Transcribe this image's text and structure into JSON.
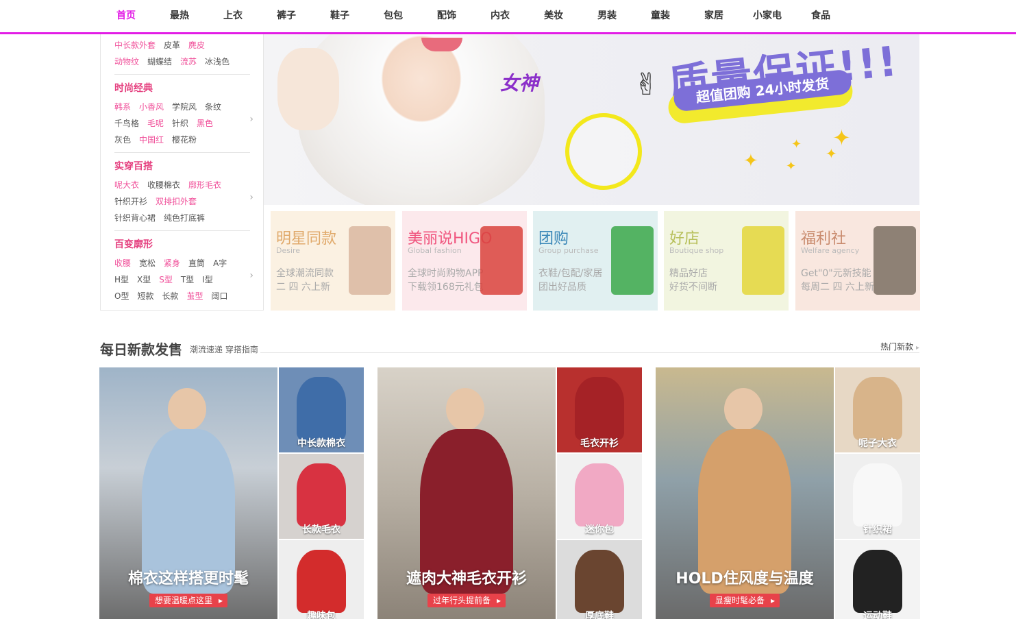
{
  "nav": {
    "items": [
      "首页",
      "最热",
      "上衣",
      "裤子",
      "鞋子",
      "包包",
      "配饰",
      "内衣",
      "美妆",
      "男装",
      "童装",
      "家居",
      "小家电",
      "食品"
    ],
    "active_index": 0
  },
  "sidebar": {
    "partial_rows": [
      [
        {
          "t": "中长款外套",
          "c": "pink"
        },
        {
          "t": "皮革",
          "c": "dark"
        },
        {
          "t": "麂皮",
          "c": "pink"
        }
      ],
      [
        {
          "t": "动物纹",
          "c": "pink"
        },
        {
          "t": "蝴蝶结",
          "c": "dark"
        },
        {
          "t": "流苏",
          "c": "pink"
        },
        {
          "t": "冰浅色",
          "c": "dark"
        }
      ]
    ],
    "groups": [
      {
        "title": "时尚经典",
        "rows": [
          [
            {
              "t": "韩系",
              "c": "pink"
            },
            {
              "t": "小香风",
              "c": "pink"
            },
            {
              "t": "学院风",
              "c": "dark"
            },
            {
              "t": "条纹",
              "c": "dark"
            }
          ],
          [
            {
              "t": "千鸟格",
              "c": "dark"
            },
            {
              "t": "毛呢",
              "c": "pink"
            },
            {
              "t": "针织",
              "c": "dark"
            },
            {
              "t": "黑色",
              "c": "pink"
            }
          ],
          [
            {
              "t": "灰色",
              "c": "dark"
            },
            {
              "t": "中国红",
              "c": "pink"
            },
            {
              "t": "樱花粉",
              "c": "dark"
            }
          ]
        ]
      },
      {
        "title": "实穿百搭",
        "rows": [
          [
            {
              "t": "呢大衣",
              "c": "pink"
            },
            {
              "t": "收腰棉衣",
              "c": "dark"
            },
            {
              "t": "廓形毛衣",
              "c": "pink"
            }
          ],
          [
            {
              "t": "针织开衫",
              "c": "dark"
            },
            {
              "t": "双排扣外套",
              "c": "pink"
            }
          ],
          [
            {
              "t": "针织背心裙",
              "c": "dark"
            },
            {
              "t": "纯色打底裤",
              "c": "dark"
            }
          ]
        ]
      },
      {
        "title": "百变廓形",
        "rows": [
          [
            {
              "t": "收腰",
              "c": "pink"
            },
            {
              "t": "宽松",
              "c": "dark"
            },
            {
              "t": "紧身",
              "c": "pink"
            },
            {
              "t": "直筒",
              "c": "dark"
            },
            {
              "t": "A字",
              "c": "dark"
            }
          ],
          [
            {
              "t": "H型",
              "c": "dark"
            },
            {
              "t": "X型",
              "c": "dark"
            },
            {
              "t": "S型",
              "c": "pink"
            },
            {
              "t": "T型",
              "c": "dark"
            },
            {
              "t": "I型",
              "c": "dark"
            }
          ],
          [
            {
              "t": "O型",
              "c": "dark"
            },
            {
              "t": "短款",
              "c": "dark"
            },
            {
              "t": "长款",
              "c": "dark"
            },
            {
              "t": "茧型",
              "c": "pink"
            },
            {
              "t": "阔口",
              "c": "dark"
            }
          ]
        ]
      }
    ]
  },
  "banner": {
    "goddess": "女神",
    "title": "质量保证",
    "exclaim": "!!!",
    "ribbon": "超值团购 24小时发货"
  },
  "promos": [
    {
      "title": "明星同款",
      "sub": "Desire",
      "l1": "全球潮流同款",
      "l2": "二 四 六上新",
      "title_color": "#e0a96a",
      "bg": "#fbf1e2",
      "thumb": "#d9b7a0"
    },
    {
      "title": "美丽说HIGO",
      "sub": "Global fashion",
      "l1": "全球时尚购物APP",
      "l2": "下载领168元礼包",
      "title_color": "#f0557e",
      "bg": "#fce9ec",
      "thumb": "#d9433d"
    },
    {
      "title": "团购",
      "sub": "Group purchase",
      "l1": "衣鞋/包配/家居",
      "l2": "团出好品质",
      "title_color": "#3c88b8",
      "bg": "#e1f0f1",
      "thumb": "#3ba84a"
    },
    {
      "title": "好店",
      "sub": "Boutique shop",
      "l1": "精品好店",
      "l2": "好货不间断",
      "title_color": "#b7bf5a",
      "bg": "#f2f5e0",
      "thumb": "#e4d63a"
    },
    {
      "title": "福利社",
      "sub": "Welfare agency",
      "l1": "Get\"0\"元新技能",
      "l2": "每周二 四 六上新",
      "title_color": "#c98b6e",
      "bg": "#f9e7df",
      "thumb": "#7b6e63"
    }
  ],
  "section": {
    "title": "每日新款发售",
    "subtitle": "潮流速递 穿搭指南",
    "more": "热门新款"
  },
  "products": [
    {
      "big": {
        "caption": "棉衣这样搭更时髦",
        "tag": "想要温暖点这里"
      },
      "smalls": [
        {
          "caption": "中长款棉衣"
        },
        {
          "caption": "长款毛衣"
        },
        {
          "caption": "趣味包"
        }
      ]
    },
    {
      "big": {
        "caption": "遮肉大神毛衣开衫",
        "tag": "过年行头提前备"
      },
      "smalls": [
        {
          "caption": "毛衣开衫"
        },
        {
          "caption": "迷你包"
        },
        {
          "caption": "厚底鞋"
        }
      ]
    },
    {
      "big": {
        "caption": "HOLD住风度与温度",
        "tag": "显瘦时髦必备"
      },
      "smalls": [
        {
          "caption": "呢子大衣"
        },
        {
          "caption": "针织裙"
        },
        {
          "caption": "运动鞋"
        }
      ]
    }
  ],
  "colors": {
    "accent": "#e21de6",
    "pink": "#f0509a",
    "tag_red": "#e8424a"
  },
  "icons": {
    "arrow": "chevron-right-icon",
    "more_arrow": "triangle-right-icon"
  }
}
